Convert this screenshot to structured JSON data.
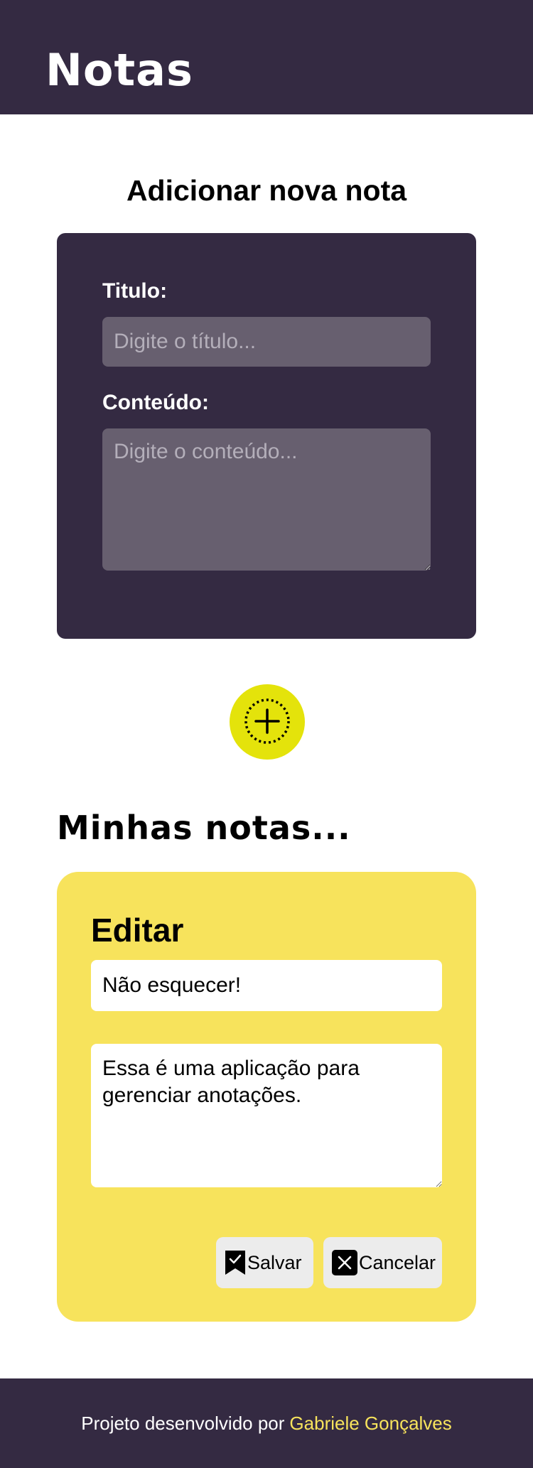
{
  "header": {
    "title": "Notas"
  },
  "add_note": {
    "heading": "Adicionar nova nota",
    "title_label": "Titulo:",
    "title_placeholder": "Digite o título...",
    "content_label": "Conteúdo:",
    "content_placeholder": "Digite o conteúdo...",
    "add_button_icon": "circle-plus-icon"
  },
  "notes": {
    "heading": "Minhas notas...",
    "edit_card": {
      "heading": "Editar",
      "title_value": "Não esquecer!",
      "content_value": "Essa é uma aplicação para gerenciar anotações.",
      "save_label": "Salvar",
      "save_icon": "bookmark-check-icon",
      "cancel_label": "Cancelar",
      "cancel_icon": "close-square-icon"
    }
  },
  "footer": {
    "text": "Projeto desenvolvido por",
    "author": "Gabriele Gonçalves"
  },
  "colors": {
    "dark": "#342a42",
    "accent_yellow": "#f7e35c",
    "add_button": "#e4e30b",
    "input_bg": "#675f6f"
  }
}
